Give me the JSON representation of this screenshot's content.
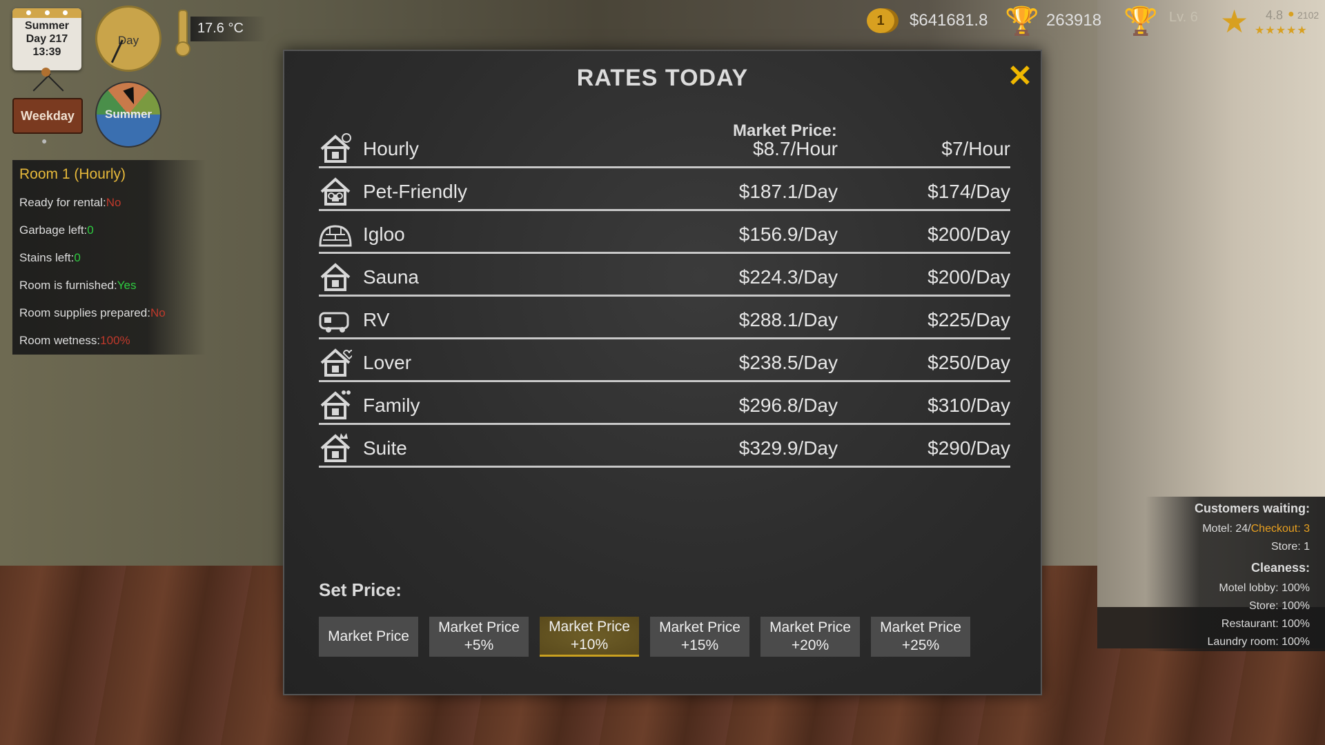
{
  "hud": {
    "season": "Summer",
    "day": "Day 217",
    "time": "13:39",
    "daytype": "Weekday",
    "clock_label": "Day",
    "season_wheel_label": "Summer",
    "temperature": "17.6 °C",
    "coin_count": "1",
    "money": "$641681.8",
    "score": "263918",
    "level": "Lv. 6",
    "rating": "4.8",
    "reviews": "2102"
  },
  "room_status": {
    "title": "Room 1 (Hourly)",
    "rows": [
      {
        "label": "Ready for rental:",
        "value": "No",
        "color": "#c0392b"
      },
      {
        "label": "Garbage left:",
        "value": "0",
        "color": "#2ecc40"
      },
      {
        "label": "Stains left:",
        "value": "0",
        "color": "#2ecc40"
      },
      {
        "label": "Room is furnished:",
        "value": "Yes",
        "color": "#2ecc40"
      },
      {
        "label": "Room supplies prepared:",
        "value": "No",
        "color": "#c0392b"
      },
      {
        "label": "Room wetness:",
        "value": "100%",
        "color": "#c0392b"
      }
    ]
  },
  "info_panel": {
    "customers_title": "Customers waiting:",
    "motel_label": "Motel: 24/",
    "checkout": "Checkout: 3",
    "store": "Store: 1",
    "cleaness_title": "Cleaness:",
    "cleaness": [
      "Motel lobby: 100%",
      "Store: 100%",
      "Restaurant: 100%",
      "Laundry room: 100%"
    ]
  },
  "dialog": {
    "title": "RATES TODAY",
    "market_header": "Market Price:",
    "rows": [
      {
        "name": "Hourly",
        "market": "$8.7/Hour",
        "price": "$7/Hour",
        "icon": "hourly-house-icon"
      },
      {
        "name": "Pet-Friendly",
        "market": "$187.1/Day",
        "price": "$174/Day",
        "icon": "pet-house-icon"
      },
      {
        "name": "Igloo",
        "market": "$156.9/Day",
        "price": "$200/Day",
        "icon": "igloo-icon"
      },
      {
        "name": "Sauna",
        "market": "$224.3/Day",
        "price": "$200/Day",
        "icon": "sauna-house-icon"
      },
      {
        "name": "RV",
        "market": "$288.1/Day",
        "price": "$225/Day",
        "icon": "rv-icon"
      },
      {
        "name": "Lover",
        "market": "$238.5/Day",
        "price": "$250/Day",
        "icon": "lover-house-icon"
      },
      {
        "name": "Family",
        "market": "$296.8/Day",
        "price": "$310/Day",
        "icon": "family-house-icon"
      },
      {
        "name": "Suite",
        "market": "$329.9/Day",
        "price": "$290/Day",
        "icon": "suite-house-icon"
      }
    ],
    "set_price_label": "Set Price:",
    "buttons": [
      {
        "line1": "Market Price",
        "line2": ""
      },
      {
        "line1": "Market Price",
        "line2": "+5%"
      },
      {
        "line1": "Market Price",
        "line2": "+10%"
      },
      {
        "line1": "Market Price",
        "line2": "+15%"
      },
      {
        "line1": "Market Price",
        "line2": "+20%"
      },
      {
        "line1": "Market Price",
        "line2": "+25%"
      }
    ],
    "selected_button": 2
  },
  "colors": {
    "accent": "#f0b800",
    "gold": "#d8a020"
  }
}
